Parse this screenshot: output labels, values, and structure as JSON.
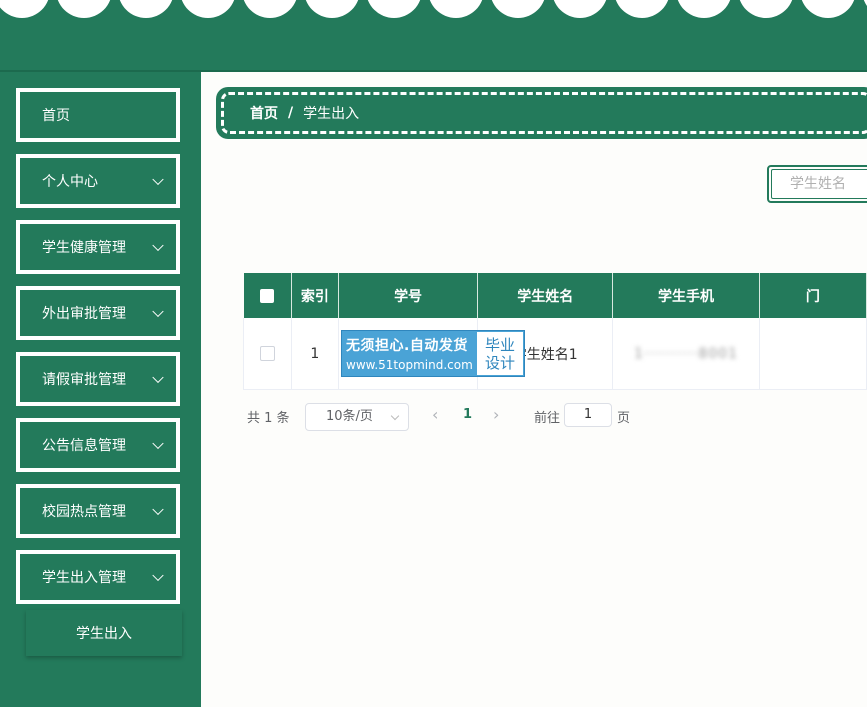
{
  "colors": {
    "primary": "#237a5b",
    "watermark": "#4aa3d6"
  },
  "sidebar": {
    "items": [
      {
        "label": "首页",
        "has_children": false
      },
      {
        "label": "个人中心",
        "has_children": true
      },
      {
        "label": "学生健康管理",
        "has_children": true
      },
      {
        "label": "外出审批管理",
        "has_children": true
      },
      {
        "label": "请假审批管理",
        "has_children": true
      },
      {
        "label": "公告信息管理",
        "has_children": true
      },
      {
        "label": "校园热点管理",
        "has_children": true
      },
      {
        "label": "学生出入管理",
        "has_children": true,
        "expanded": true
      }
    ],
    "subitem": {
      "label": "学生出入"
    }
  },
  "breadcrumb": {
    "home": "首页",
    "separator": "/",
    "current": "学生出入"
  },
  "search": {
    "placeholder": "学生姓名",
    "value": ""
  },
  "table": {
    "columns": [
      "索引",
      "学号",
      "学生姓名",
      "学生手机",
      "门"
    ],
    "rows": [
      {
        "index": "1",
        "student_no": "",
        "student_name": "学生姓名1",
        "phone": "1··········8001"
      }
    ]
  },
  "watermark": {
    "line1": "无须担心.自动发货",
    "line2": "www.51topmind.com",
    "badge_line1": "毕业",
    "badge_line2": "设计"
  },
  "pagination": {
    "total_text": "共 1 条",
    "page_size": "10条/页",
    "current_page": "1",
    "goto_label": "前往",
    "goto_value": "1",
    "goto_unit": "页"
  }
}
